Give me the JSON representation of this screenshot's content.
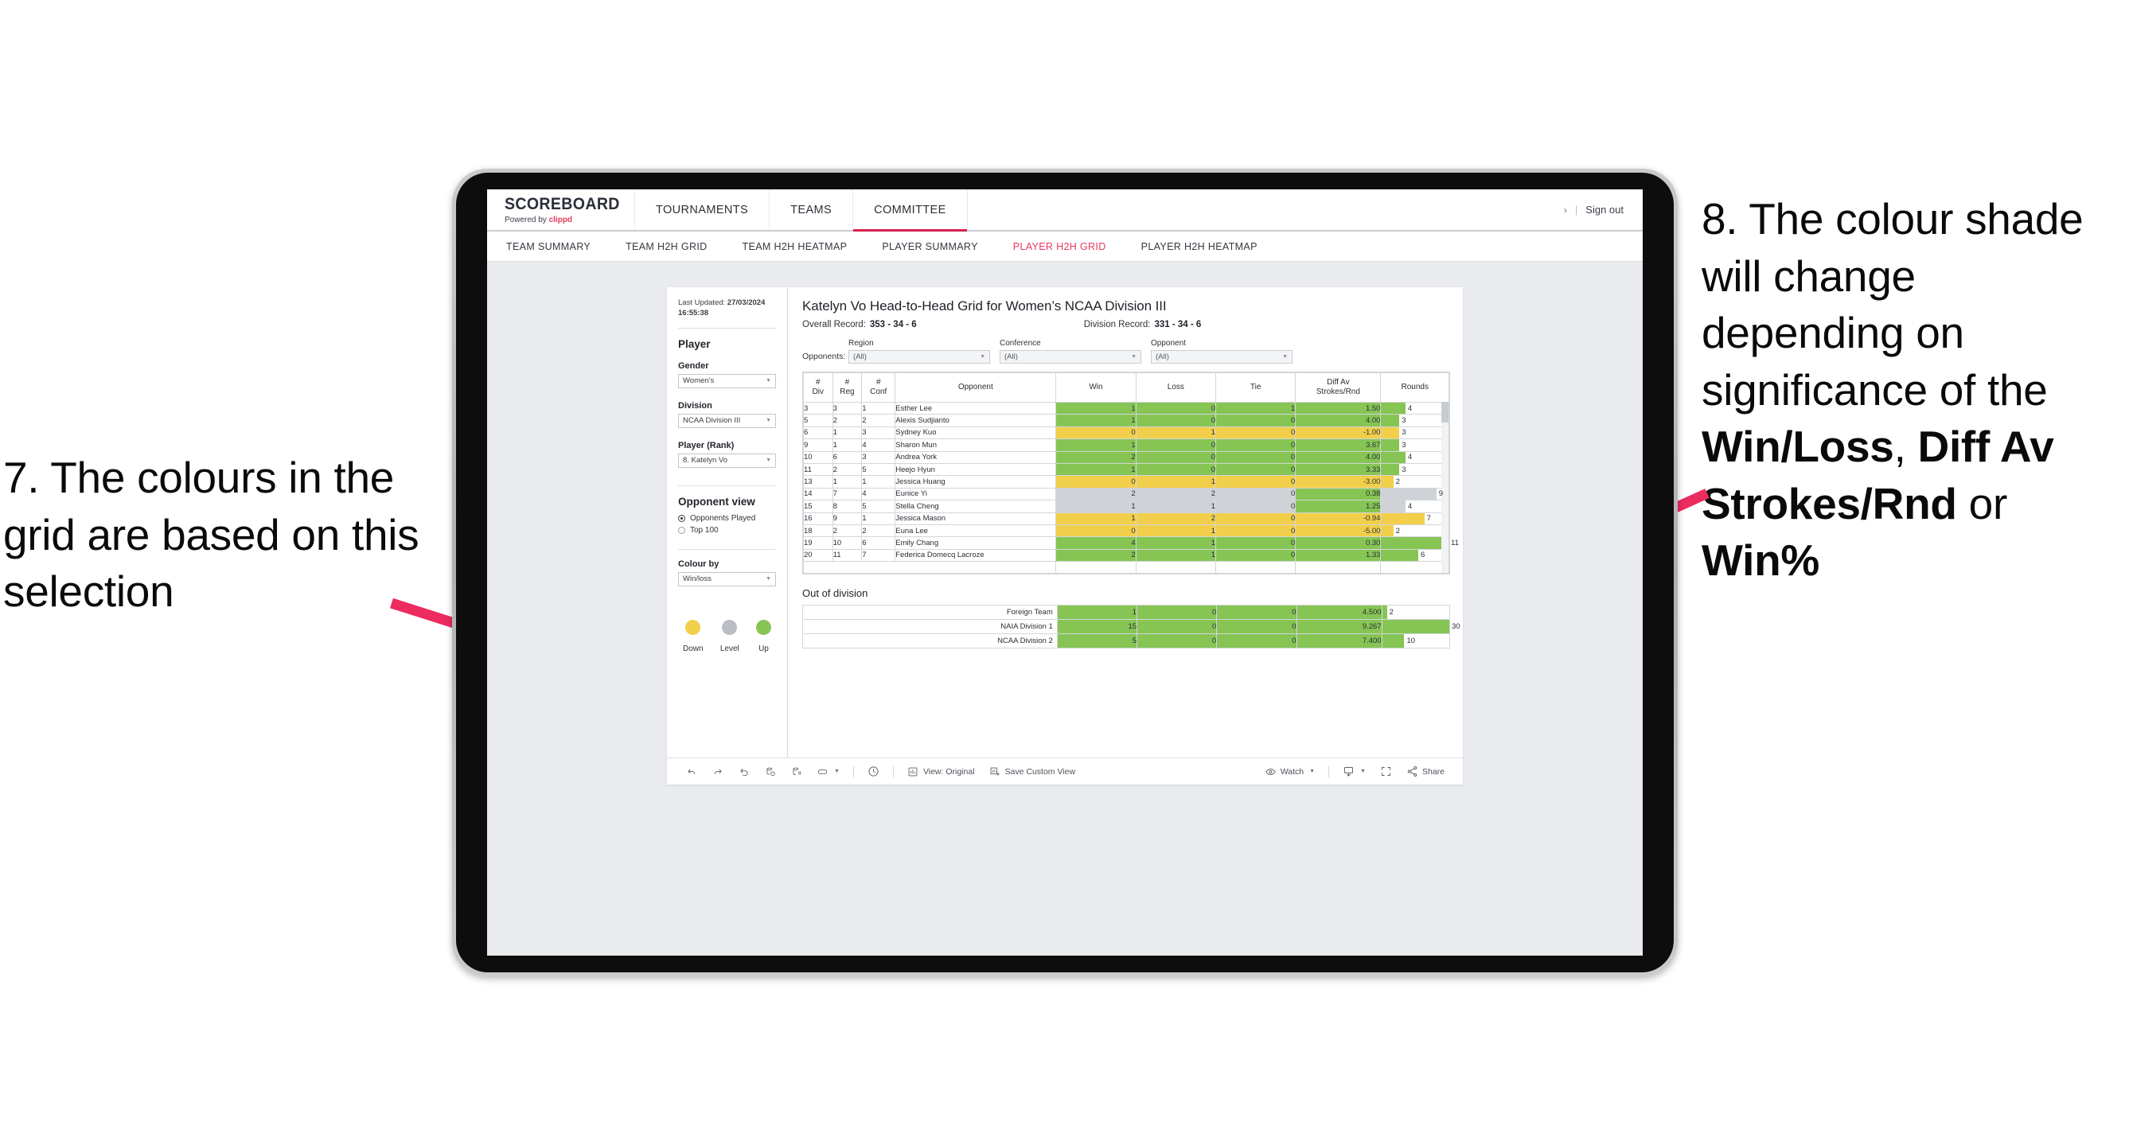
{
  "annotations": {
    "left": "7. The colours in the grid are based on this selection",
    "right_pre": "8. The colour shade will change depending on significance of the ",
    "right_b1": "Win/Loss",
    "right_mid1": ", ",
    "right_b2": "Diff Av Strokes/Rnd",
    "right_mid2": " or ",
    "right_b3": "Win%",
    "arrow_color": "#ec2b5e"
  },
  "topbar": {
    "brand_title": "SCOREBOARD",
    "brand_sub_pre": "Powered by ",
    "brand_sub_name": "clippd",
    "nav": [
      {
        "label": "TOURNAMENTS",
        "active": false
      },
      {
        "label": "TEAMS",
        "active": false
      },
      {
        "label": "COMMITTEE",
        "active": true
      }
    ],
    "chevron": "›",
    "separator": "|",
    "signout": "Sign out"
  },
  "subnav": {
    "items": [
      {
        "label": "TEAM SUMMARY",
        "active": false
      },
      {
        "label": "TEAM H2H GRID",
        "active": false
      },
      {
        "label": "TEAM H2H HEATMAP",
        "active": false
      },
      {
        "label": "PLAYER SUMMARY",
        "active": false
      },
      {
        "label": "PLAYER H2H GRID",
        "active": true
      },
      {
        "label": "PLAYER H2H HEATMAP",
        "active": false
      }
    ]
  },
  "sidebar": {
    "last_updated_label": "Last Updated:",
    "last_updated_value": "27/03/2024 16:55:38",
    "player_section_title": "Player",
    "fields": [
      {
        "label": "Gender",
        "value": "Women’s"
      },
      {
        "label": "Division",
        "value": "NCAA Division III"
      },
      {
        "label": "Player (Rank)",
        "value": "8. Katelyn Vo"
      }
    ],
    "opponent_view_title": "Opponent view",
    "opponent_view_options": [
      {
        "label": "Opponents Played",
        "selected": true
      },
      {
        "label": "Top 100",
        "selected": false
      }
    ],
    "colour_by_label": "Colour by",
    "colour_by_value": "Win/loss",
    "legend": [
      {
        "label": "Down",
        "color": "#f2cf4a"
      },
      {
        "label": "Level",
        "color": "#b9bec4"
      },
      {
        "label": "Up",
        "color": "#86c554"
      }
    ]
  },
  "main": {
    "title": "Katelyn Vo Head-to-Head Grid for Women’s NCAA Division III",
    "overall_record_label": "Overall Record:",
    "overall_record_value": "353 -  34 - 6",
    "division_record_label": "Division Record:",
    "division_record_value": "331 -  34 - 6",
    "opponents_label": "Opponents:",
    "filters": [
      {
        "label": "Region",
        "value": "(All)"
      },
      {
        "label": "Conference",
        "value": "(All)"
      },
      {
        "label": "Opponent",
        "value": "(All)"
      }
    ]
  },
  "chart_data": {
    "type": "table",
    "title": "Katelyn Vo Head-to-Head Grid for Women’s NCAA Division III",
    "columns": [
      "# Div",
      "# Reg",
      "# Conf",
      "Opponent",
      "Win",
      "Loss",
      "Tie",
      "Diff Av Strokes/Rnd",
      "Rounds"
    ],
    "colors": {
      "up": "#86c554",
      "down": "#f2cf4a",
      "level": "#cfd2d6",
      "white": "#ffffff"
    },
    "rounds_max": 11,
    "rows": [
      {
        "div": "3",
        "reg": "3",
        "conf": "1",
        "opponent": "Esther Lee",
        "win": "1",
        "loss": "0",
        "tie": "1",
        "diff": "1.50",
        "rounds": "4",
        "shade": "up"
      },
      {
        "div": "5",
        "reg": "2",
        "conf": "2",
        "opponent": "Alexis Sudjianto",
        "win": "1",
        "loss": "0",
        "tie": "0",
        "diff": "4.00",
        "rounds": "3",
        "shade": "up"
      },
      {
        "div": "6",
        "reg": "1",
        "conf": "3",
        "opponent": "Sydney Kuo",
        "win": "0",
        "loss": "1",
        "tie": "0",
        "diff": "-1.00",
        "rounds": "3",
        "shade": "down"
      },
      {
        "div": "9",
        "reg": "1",
        "conf": "4",
        "opponent": "Sharon Mun",
        "win": "1",
        "loss": "0",
        "tie": "0",
        "diff": "3.67",
        "rounds": "3",
        "shade": "up"
      },
      {
        "div": "10",
        "reg": "6",
        "conf": "3",
        "opponent": "Andrea York",
        "win": "2",
        "loss": "0",
        "tie": "0",
        "diff": "4.00",
        "rounds": "4",
        "shade": "up"
      },
      {
        "div": "11",
        "reg": "2",
        "conf": "5",
        "opponent": "Heejo Hyun",
        "win": "1",
        "loss": "0",
        "tie": "0",
        "diff": "3.33",
        "rounds": "3",
        "shade": "up"
      },
      {
        "div": "13",
        "reg": "1",
        "conf": "1",
        "opponent": "Jessica Huang",
        "win": "0",
        "loss": "1",
        "tie": "0",
        "diff": "-3.00",
        "rounds": "2",
        "shade": "down"
      },
      {
        "div": "14",
        "reg": "7",
        "conf": "4",
        "opponent": "Eunice Yi",
        "win": "2",
        "loss": "2",
        "tie": "0",
        "diff": "0.38",
        "rounds": "9",
        "shade": "level",
        "diff_shade": "up"
      },
      {
        "div": "15",
        "reg": "8",
        "conf": "5",
        "opponent": "Stella Cheng",
        "win": "1",
        "loss": "1",
        "tie": "0",
        "diff": "1.25",
        "rounds": "4",
        "shade": "level",
        "diff_shade": "up"
      },
      {
        "div": "16",
        "reg": "9",
        "conf": "1",
        "opponent": "Jessica Mason",
        "win": "1",
        "loss": "2",
        "tie": "0",
        "diff": "-0.94",
        "rounds": "7",
        "shade": "down"
      },
      {
        "div": "18",
        "reg": "2",
        "conf": "2",
        "opponent": "Euna Lee",
        "win": "0",
        "loss": "1",
        "tie": "0",
        "diff": "-5.00",
        "rounds": "2",
        "shade": "down"
      },
      {
        "div": "19",
        "reg": "10",
        "conf": "6",
        "opponent": "Emily Chang",
        "win": "4",
        "loss": "1",
        "tie": "0",
        "diff": "0.30",
        "rounds": "11",
        "shade": "up"
      },
      {
        "div": "20",
        "reg": "11",
        "conf": "7",
        "opponent": "Federica Domecq Lacroze",
        "win": "2",
        "loss": "1",
        "tie": "0",
        "diff": "1.33",
        "rounds": "6",
        "shade": "up"
      }
    ],
    "out_of_division": {
      "title": "Out of division",
      "rounds_max": 30,
      "rows": [
        {
          "label": "Foreign Team",
          "win": "1",
          "loss": "0",
          "tie": "0",
          "diff": "4.500",
          "rounds": "2",
          "shade": "up"
        },
        {
          "label": "NAIA Division 1",
          "win": "15",
          "loss": "0",
          "tie": "0",
          "diff": "9.267",
          "rounds": "30",
          "shade": "up"
        },
        {
          "label": "NCAA Division 2",
          "win": "5",
          "loss": "0",
          "tie": "0",
          "diff": "7.400",
          "rounds": "10",
          "shade": "up"
        }
      ]
    }
  },
  "toolbar": {
    "view_label": "View: Original",
    "save_label": "Save Custom View",
    "watch_label": "Watch",
    "share_label": "Share"
  }
}
